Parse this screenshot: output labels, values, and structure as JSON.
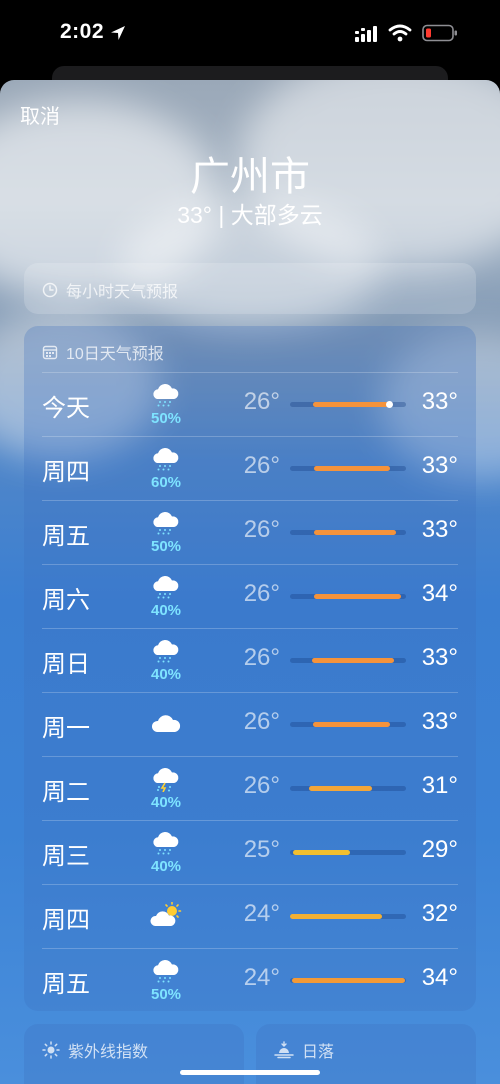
{
  "status_bar": {
    "time": "2:02"
  },
  "header": {
    "cancel_label": "取消",
    "city": "广州市",
    "summary": "33° | 大部多云"
  },
  "hourly": {
    "title": "每小时天气预报",
    "icon": "clock-icon"
  },
  "daily": {
    "title": "10日天气预报",
    "icon": "calendar-icon",
    "days": [
      {
        "day": "今天",
        "icon": "cloud-rain-icon",
        "pop": "50%",
        "low": "26°",
        "high": "33°",
        "bar_start": 0.2,
        "bar_end": 0.87,
        "bar_color": "#f5933b",
        "now_dot": 0.85
      },
      {
        "day": "周四",
        "icon": "cloud-rain-icon",
        "pop": "60%",
        "low": "26°",
        "high": "33°",
        "bar_start": 0.21,
        "bar_end": 0.86,
        "bar_color": "#f5933b"
      },
      {
        "day": "周五",
        "icon": "cloud-rain-icon",
        "pop": "50%",
        "low": "26°",
        "high": "33°",
        "bar_start": 0.21,
        "bar_end": 0.91,
        "bar_color": "#f5933b"
      },
      {
        "day": "周六",
        "icon": "cloud-rain-icon",
        "pop": "40%",
        "low": "26°",
        "high": "34°",
        "bar_start": 0.21,
        "bar_end": 0.96,
        "bar_color": "#f5933b"
      },
      {
        "day": "周日",
        "icon": "cloud-rain-icon",
        "pop": "40%",
        "low": "26°",
        "high": "33°",
        "bar_start": 0.19,
        "bar_end": 0.9,
        "bar_color": "#f5933b"
      },
      {
        "day": "周一",
        "icon": "cloud-icon",
        "pop": "",
        "low": "26°",
        "high": "33°",
        "bar_start": 0.2,
        "bar_end": 0.86,
        "bar_color": "#f5933b"
      },
      {
        "day": "周二",
        "icon": "cloud-bolt-rain-icon",
        "pop": "40%",
        "low": "26°",
        "high": "31°",
        "bar_start": 0.16,
        "bar_end": 0.71,
        "bar_color": "#f2a63a"
      },
      {
        "day": "周三",
        "icon": "cloud-rain-icon",
        "pop": "40%",
        "low": "25°",
        "high": "29°",
        "bar_start": 0.03,
        "bar_end": 0.52,
        "bar_color": "#f2bf2f"
      },
      {
        "day": "周四",
        "icon": "cloud-sun-icon",
        "pop": "",
        "low": "24°",
        "high": "32°",
        "bar_start": 0.0,
        "bar_end": 0.79,
        "bar_color": "#f2b033"
      },
      {
        "day": "周五",
        "icon": "cloud-rain-icon",
        "pop": "50%",
        "low": "24°",
        "high": "34°",
        "bar_start": 0.02,
        "bar_end": 0.99,
        "bar_color": "#f39a37"
      }
    ]
  },
  "uv": {
    "title": "紫外线指数",
    "icon": "sun-icon"
  },
  "sunset": {
    "title": "日落",
    "icon": "sunset-icon"
  }
}
